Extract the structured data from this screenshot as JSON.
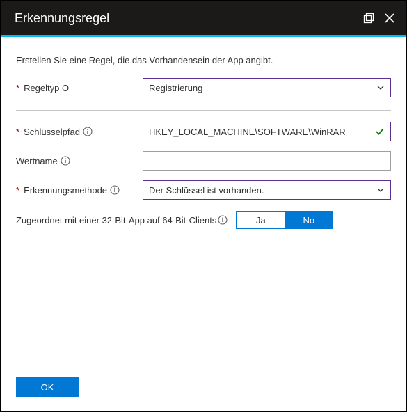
{
  "header": {
    "title": "Erkennungsregel"
  },
  "instruction": "Erstellen Sie eine Regel, die das Vorhandensein der App angibt.",
  "fields": {
    "ruletype": {
      "label": "Regeltyp O",
      "value": "Registrierung"
    },
    "keypath": {
      "label": "Schlüsselpfad",
      "value": "HKEY_LOCAL_MACHINE\\SOFTWARE\\WinRAR"
    },
    "valuename": {
      "label": "Wertname",
      "value": ""
    },
    "method": {
      "label": "Erkennungsmethode",
      "value": "Der Schlüssel ist vorhanden."
    },
    "assoc": {
      "label": "Zugeordnet mit einer 32-Bit-App auf 64-Bit-Clients",
      "yes": "Ja",
      "no": "No"
    }
  },
  "buttons": {
    "ok": "OK"
  }
}
